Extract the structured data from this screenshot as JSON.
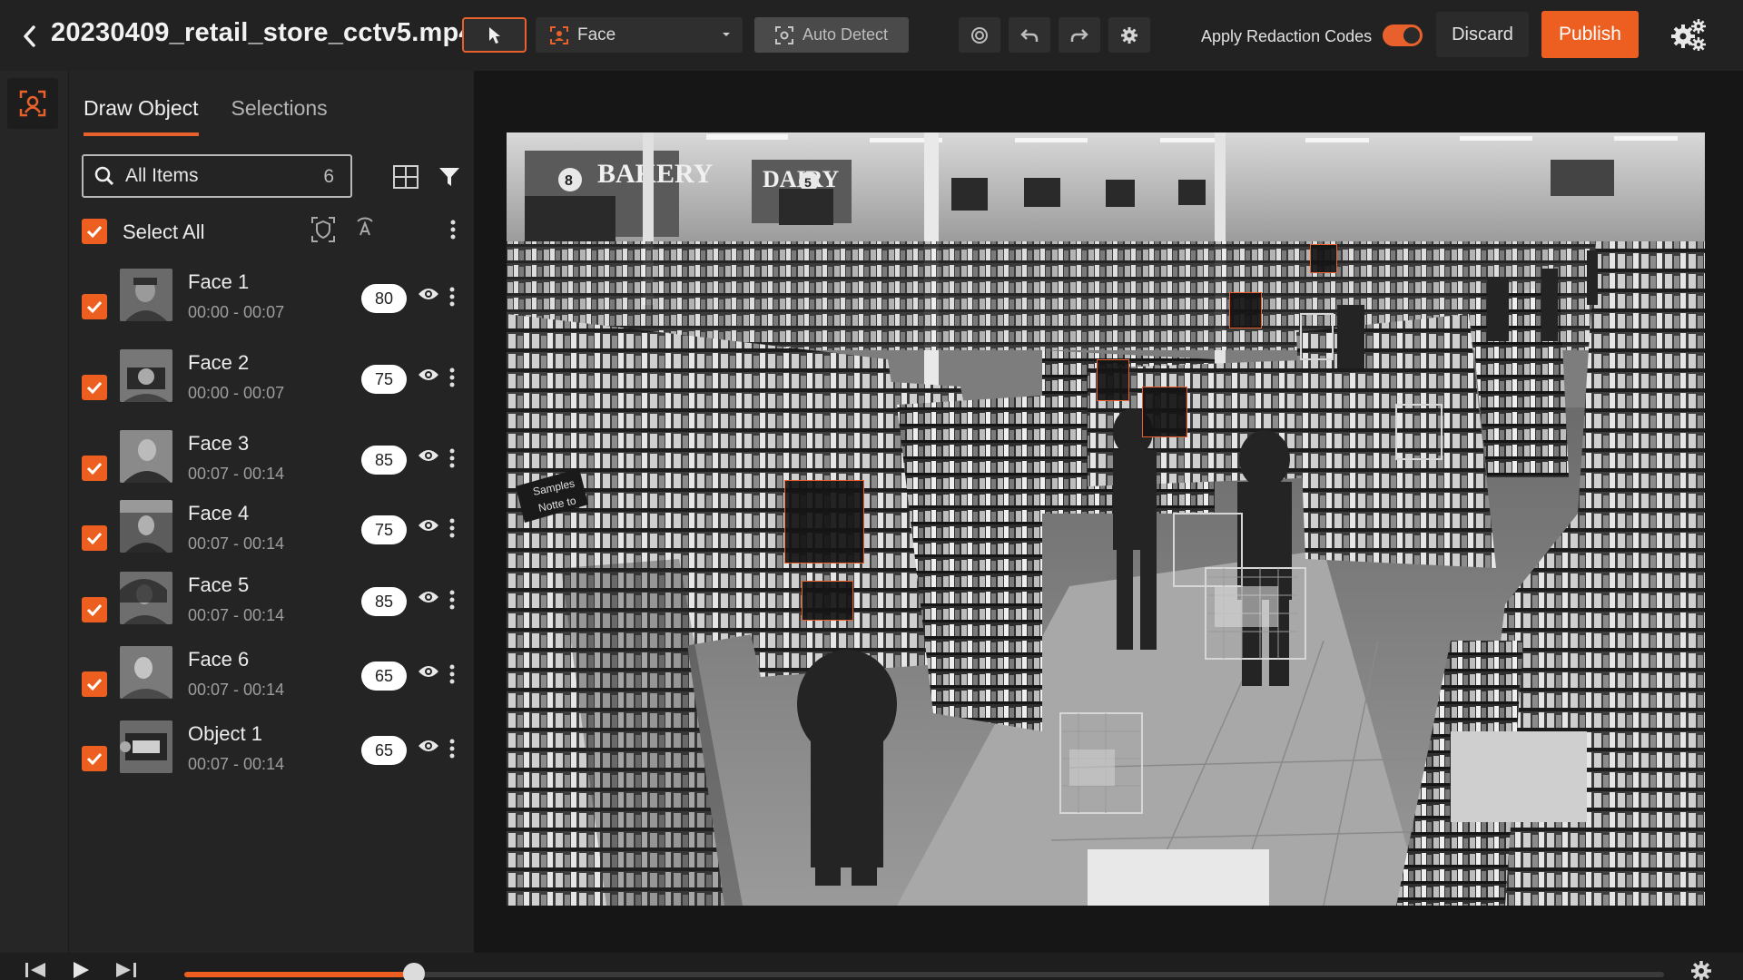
{
  "header": {
    "file_title": "20230409_retail_store_cctv5.mp4",
    "detection_type": "Face",
    "auto_detect_label": "Auto Detect",
    "apply_codes_label": "Apply Redaction Codes",
    "apply_codes_enabled": true,
    "discard_label": "Discard",
    "publish_label": "Publish"
  },
  "panel": {
    "tabs": [
      {
        "label": "Draw Object",
        "active": true
      },
      {
        "label": "Selections",
        "active": false
      }
    ],
    "search": {
      "label": "All Items",
      "count": "6"
    },
    "select_all_label": "Select All",
    "items": [
      {
        "name": "Face 1",
        "time": "00:00 - 00:07",
        "score": "80",
        "checked": true
      },
      {
        "name": "Face 2",
        "time": "00:00 - 00:07",
        "score": "75",
        "checked": true
      },
      {
        "name": "Face 3",
        "time": "00:07 - 00:14",
        "score": "85",
        "checked": true
      },
      {
        "name": "Face 4",
        "time": "00:07 - 00:14",
        "score": "75",
        "checked": true
      },
      {
        "name": "Face 5",
        "time": "00:07 - 00:14",
        "score": "85",
        "checked": true
      },
      {
        "name": "Face 6",
        "time": "00:07 - 00:14",
        "score": "65",
        "checked": true
      },
      {
        "name": "Object 1",
        "time": "00:07 - 00:14",
        "score": "65",
        "checked": true
      }
    ]
  },
  "viewer": {
    "signs": [
      "BAKERY",
      "DAIRY",
      "8",
      "5",
      "Samples",
      "Notte to"
    ]
  },
  "timeline": {
    "progress": 0.155
  },
  "colors": {
    "accent": "#ec5f20",
    "background": "#1f1f1f"
  },
  "icons": [
    "chevron-left-icon",
    "cursor-icon",
    "face-scan-icon",
    "chevron-down-icon",
    "auto-detect-icon",
    "target-icon",
    "undo-icon",
    "redo-icon",
    "gear-icon",
    "settings-gears-icon",
    "search-icon",
    "grid-icon",
    "filter-icon",
    "shield-face-icon",
    "auto-redact-icon",
    "eye-icon",
    "kebab-icon",
    "skip-back-icon",
    "play-icon",
    "skip-forward-icon"
  ]
}
